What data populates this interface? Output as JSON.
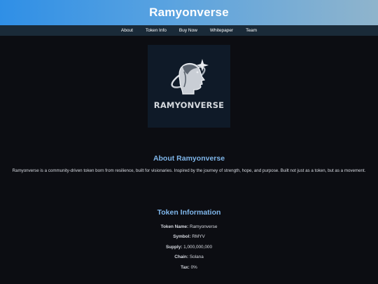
{
  "header": {
    "title": "Ramyonverse"
  },
  "nav": {
    "items": [
      {
        "label": "About"
      },
      {
        "label": "Token Info"
      },
      {
        "label": "Buy Now"
      },
      {
        "label": "Whitepaper"
      },
      {
        "label": "Team"
      }
    ]
  },
  "logo": {
    "text": "RAMYONVERSE"
  },
  "about": {
    "title": "About Ramyonverse",
    "text": "Ramyonverse is a community-driven token born from resilience, built for visionaries. Inspired by the journey of strength, hope, and purpose. Built not just as a token, but as a movement."
  },
  "token_info": {
    "title": "Token Information",
    "rows": [
      {
        "key": "Token Name:",
        "value": "Ramyonverse"
      },
      {
        "key": "Symbol:",
        "value": "RMYV"
      },
      {
        "key": "Supply:",
        "value": "1,000,000,000"
      },
      {
        "key": "Chain:",
        "value": "Solana"
      },
      {
        "key": "Tax:",
        "value": "0%"
      }
    ]
  },
  "colors": {
    "header_gradient_start": "#2f8fe6",
    "header_gradient_end": "#8fb4cc",
    "nav_bg": "#1a2a38",
    "accent": "#7fb6ea",
    "page_bg": "#0c0d12"
  }
}
